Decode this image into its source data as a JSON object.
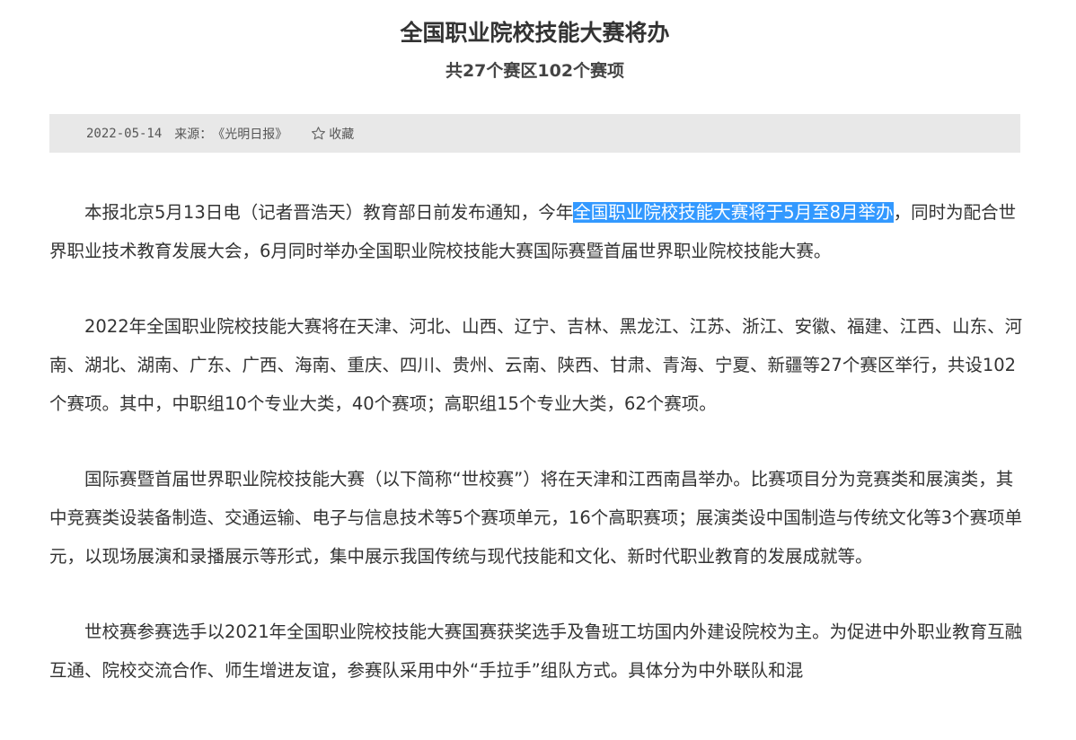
{
  "article": {
    "title": "全国职业院校技能大赛将办",
    "subtitle": "共27个赛区102个赛项",
    "meta": {
      "date": "2022-05-14",
      "source_label": "来源：",
      "source": "《光明日报》",
      "favorite_label": "收藏",
      "favorite_icon": "star-outline-icon"
    },
    "paragraphs": [
      {
        "before": "本报北京5月13日电（记者晋浩天）教育部日前发布通知，今年",
        "selected": "全国职业院校技能大赛将于5月至8月举办",
        "after": "，同时为配合世界职业技术教育发展大会，6月同时举办全国职业院校技能大赛国际赛暨首届世界职业院校技能大赛。"
      },
      {
        "text": "2022年全国职业院校技能大赛将在天津、河北、山西、辽宁、吉林、黑龙江、江苏、浙江、安徽、福建、江西、山东、河南、湖北、湖南、广东、广西、海南、重庆、四川、贵州、云南、陕西、甘肃、青海、宁夏、新疆等27个赛区举行，共设102个赛项。其中，中职组10个专业大类，40个赛项；高职组15个专业大类，62个赛项。"
      },
      {
        "text": "国际赛暨首届世界职业院校技能大赛（以下简称“世校赛”）将在天津和江西南昌举办。比赛项目分为竞赛类和展演类，其中竞赛类设装备制造、交通运输、电子与信息技术等5个赛项单元，16个高职赛项；展演类设中国制造与传统文化等3个赛项单元，以现场展演和录播展示等形式，集中展示我国传统与现代技能和文化、新时代职业教育的发展成就等。"
      },
      {
        "text": "世校赛参赛选手以2021年全国职业院校技能大赛国赛获奖选手及鲁班工坊国内外建设院校为主。为促进中外职业教育互融互通、院校交流合作、师生增进友谊，参赛队采用中外“手拉手”组队方式。具体分为中外联队和混"
      }
    ]
  },
  "colors": {
    "meta_bar_bg": "#e8e8e8",
    "selection_bg": "#3399ff",
    "text": "#333333"
  }
}
